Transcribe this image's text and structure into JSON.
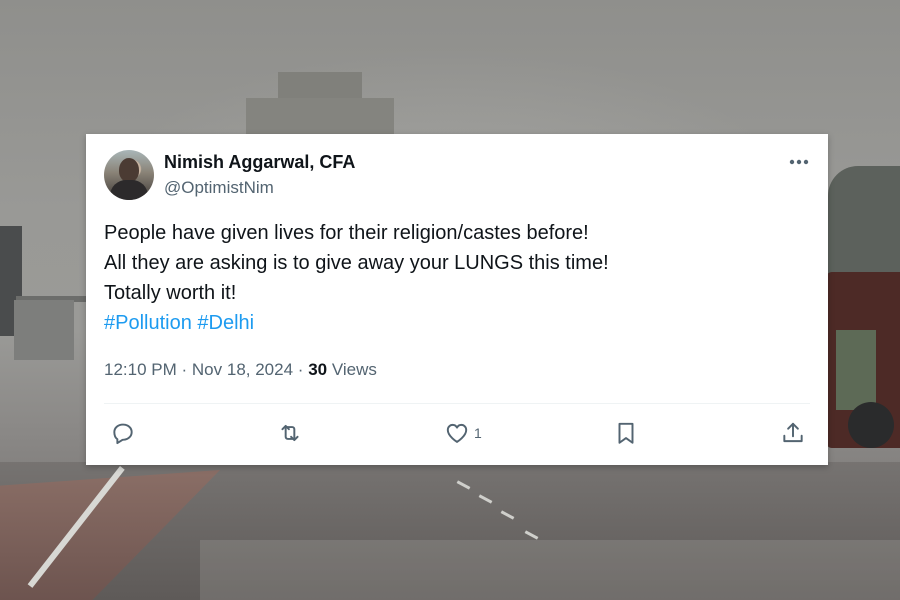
{
  "tweet": {
    "author_name": "Nimish Aggarwal, CFA",
    "handle": "@OptimistNim",
    "text_lines": [
      "People have given lives for their religion/castes before!",
      "All they are asking is to give away your LUNGS this time!",
      "Totally worth it!"
    ],
    "hashtags": [
      "#Pollution",
      "#Delhi"
    ],
    "time": "12:10 PM",
    "separator": "·",
    "date": "Nov 18, 2024",
    "views_count": "30",
    "views_label": "Views",
    "actions": {
      "reply": {
        "icon": "reply-icon"
      },
      "retweet": {
        "icon": "retweet-icon"
      },
      "like": {
        "icon": "heart-icon",
        "count": "1"
      },
      "bookmark": {
        "icon": "bookmark-icon"
      },
      "share": {
        "icon": "share-icon"
      }
    }
  },
  "colors": {
    "text_primary": "#0f1419",
    "text_secondary": "#536471",
    "link": "#1d9bf0",
    "card_bg": "#ffffff"
  }
}
